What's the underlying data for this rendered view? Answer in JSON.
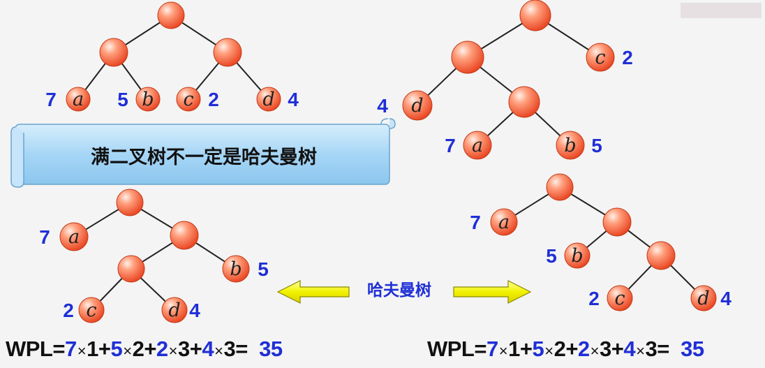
{
  "banner": {
    "text": "满二叉树不一定是哈夫曼树"
  },
  "arrow_label": {
    "text": "哈夫曼树"
  },
  "leaves": {
    "a": {
      "letter": "a",
      "weight": "7"
    },
    "b": {
      "letter": "b",
      "weight": "5"
    },
    "c": {
      "letter": "c",
      "weight": "2"
    },
    "d": {
      "letter": "d",
      "weight": "4"
    }
  },
  "wpl_left": {
    "prefix": "WPL=",
    "terms": [
      {
        "w": "7",
        "times": "×",
        "d": "1",
        "op": "+"
      },
      {
        "w": "5",
        "times": "×",
        "d": "2",
        "op": "+"
      },
      {
        "w": "2",
        "times": "×",
        "d": "3",
        "op": "+"
      },
      {
        "w": "4",
        "times": "×",
        "d": "3",
        "op": "="
      }
    ],
    "result": "35"
  },
  "wpl_right": {
    "prefix": "WPL=",
    "terms": [
      {
        "w": "7",
        "times": "×",
        "d": "1",
        "op": "+"
      },
      {
        "w": "5",
        "times": "×",
        "d": "2",
        "op": "+"
      },
      {
        "w": "2",
        "times": "×",
        "d": "3",
        "op": "+"
      },
      {
        "w": "4",
        "times": "×",
        "d": "3",
        "op": "="
      }
    ],
    "result": "35"
  },
  "colors": {
    "node_fill": "#f26b45",
    "node_highlight": "#ffd3c2",
    "weight_text": "#1f2fd6",
    "banner_fill": "#aad8f7",
    "arrow_fill": "#f5f500"
  }
}
